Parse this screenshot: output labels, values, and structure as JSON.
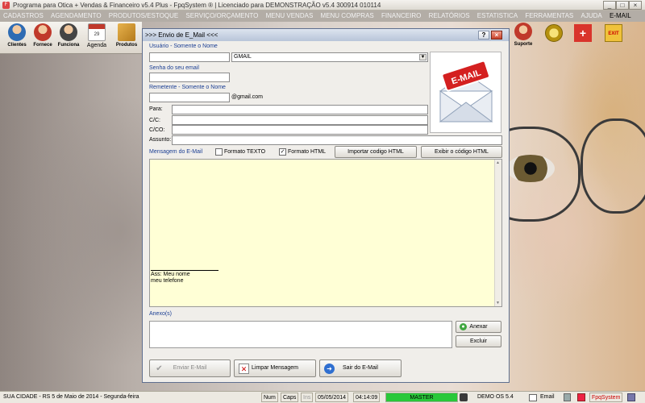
{
  "window": {
    "title": "Programa para Otica + Vendas & Financeiro v5.4 Plus - FpqSystem ® | Licenciado para  DEMONSTRAÇÃO v5.4 300914 010114",
    "minimize": "_",
    "maximize": "□",
    "close": "×"
  },
  "menu": [
    "CADASTROS",
    "AGENDAMENTO",
    "PRODUTOS/ESTOQUE",
    "SERVIÇO/ORÇAMENTO",
    "MENU VENDAS",
    "MENU COMPRAS",
    "FINANCEIRO",
    "RELATÓRIOS",
    "ESTATISTICA",
    "FERRAMENTAS",
    "AJUDA",
    "E-MAIL"
  ],
  "toolbar": {
    "clientes": "Clientes",
    "fornece": "Fornece",
    "funciona": "Funciona",
    "agenda": "Agenda",
    "produtos": "Produtos",
    "calendar_day": "29",
    "suporte": "Suporte"
  },
  "dialog": {
    "title": ">>> Envio de E_Mail <<<",
    "help": "?",
    "usuario_label": "Usuário - Somente o Nome",
    "provider": "GMAIL",
    "senha_label": "Senha do seu email",
    "remetente_label": "Remetente - Somente o Nome",
    "domain": "@gmail.com",
    "para_label": "Para:",
    "cc_label": "C/C:",
    "cco_label": "C/CO:",
    "assunto_label": "Assunto:",
    "mensagem_label": "Mensagem do E-Mail",
    "formato_texto": "Formato TEXTO",
    "formato_html": "Formato HTML",
    "importar": "Importar codigo HTML",
    "exibir": "Exibir o código HTML",
    "sig_name": "Ass: Meu  nome",
    "sig_phone": "meu telefone",
    "anexos_label": "Anexo(s)",
    "anexar": "Anexar",
    "excluir": "Excluir",
    "enviar": "Enviar E-Mail",
    "limpar": "Limpar Mensagem",
    "sair": "Sair do E-Mail",
    "mail_badge": "E-MAIL"
  },
  "status": {
    "city": "SUA CIDADE - RS  5 de Maio de 2014 - Segunda-feira",
    "num": "Num",
    "caps": "Caps",
    "ins": "Ins",
    "date": "05/05/2014",
    "time": "04:14:09",
    "master": "MASTER",
    "demo": "DEMO OS 5.4",
    "email": "Email",
    "brand": "FpqSystem"
  },
  "colors": {
    "menu_bg": "#b3ada6",
    "dialog_bg": "#f0eeea",
    "message_bg": "#ffffd6",
    "master_bg": "#29c83a",
    "label_blue": "#1a3e93"
  }
}
